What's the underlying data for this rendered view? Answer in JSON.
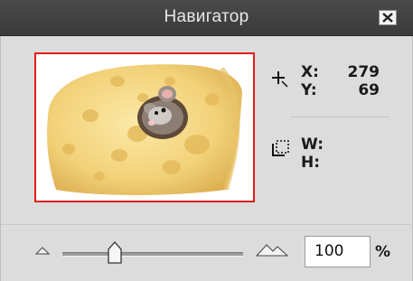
{
  "window": {
    "title": "Навигатор",
    "close_icon": "close-icon"
  },
  "info": {
    "x_label": "X:",
    "x_value": "279",
    "y_label": "Y:",
    "y_value": "69",
    "w_label": "W:",
    "h_label": "H:",
    "cursor_icon": "crosshair-icon",
    "selection_icon": "selection-size-icon"
  },
  "zoom": {
    "value": "100",
    "unit": "%",
    "level_fraction": 0.29,
    "zoom_out_icon": "small-mountain-icon",
    "zoom_in_icon": "large-mountain-icon"
  },
  "colors": {
    "preview_border": "#e11c1c",
    "panel_bg": "#dcdcdc",
    "titlebar": "#3f3f3f"
  }
}
